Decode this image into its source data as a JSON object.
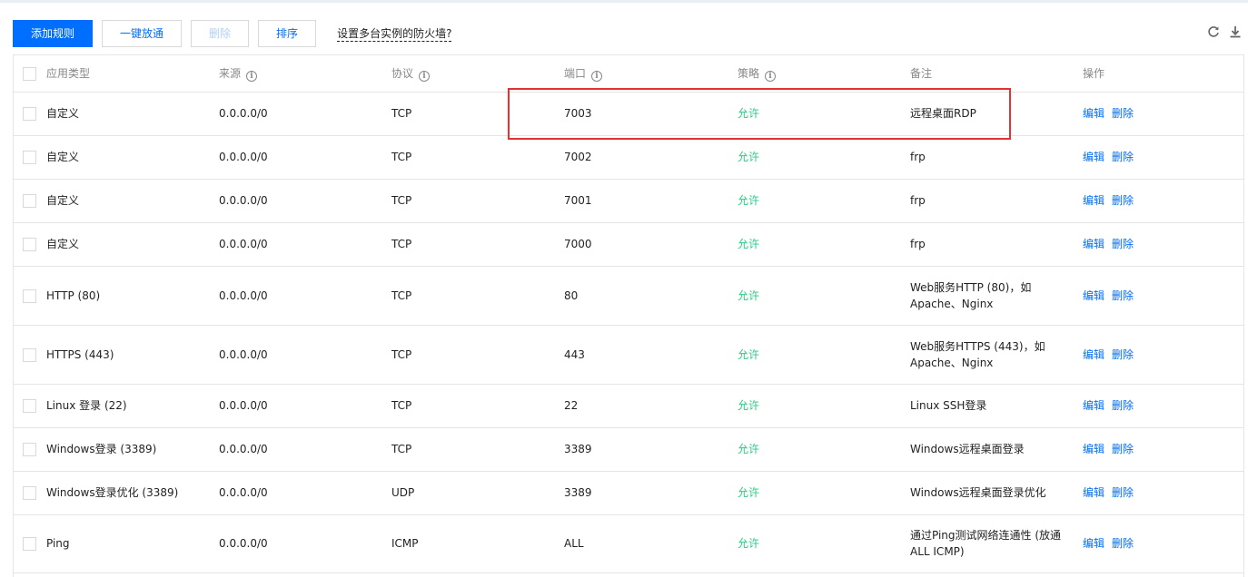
{
  "toolbar": {
    "add_rule": "添加规则",
    "one_click_allow": "一键放通",
    "delete": "删除",
    "sort": "排序",
    "multi_instance_link": "设置多台实例的防火墙?"
  },
  "icons": {
    "refresh": "refresh-icon",
    "download": "download-icon",
    "info": "info-icon"
  },
  "colors": {
    "primary": "#006eff",
    "allow": "#29cc85",
    "highlight": "#e03333"
  },
  "table": {
    "headers": {
      "type": "应用类型",
      "source": "来源",
      "protocol": "协议",
      "port": "端口",
      "policy": "策略",
      "note": "备注",
      "actions": "操作"
    },
    "edit_label": "编辑",
    "delete_label": "删除",
    "rows": [
      {
        "type": "自定义",
        "source": "0.0.0.0/0",
        "protocol": "TCP",
        "port": "7003",
        "policy": "允许",
        "note_lines": [
          "远程桌面RDP"
        ]
      },
      {
        "type": "自定义",
        "source": "0.0.0.0/0",
        "protocol": "TCP",
        "port": "7002",
        "policy": "允许",
        "note_lines": [
          "frp"
        ]
      },
      {
        "type": "自定义",
        "source": "0.0.0.0/0",
        "protocol": "TCP",
        "port": "7001",
        "policy": "允许",
        "note_lines": [
          "frp"
        ]
      },
      {
        "type": "自定义",
        "source": "0.0.0.0/0",
        "protocol": "TCP",
        "port": "7000",
        "policy": "允许",
        "note_lines": [
          "frp"
        ]
      },
      {
        "type": "HTTP (80)",
        "source": "0.0.0.0/0",
        "protocol": "TCP",
        "port": "80",
        "policy": "允许",
        "note_lines": [
          "Web服务HTTP (80)，如",
          "Apache、Nginx"
        ]
      },
      {
        "type": "HTTPS (443)",
        "source": "0.0.0.0/0",
        "protocol": "TCP",
        "port": "443",
        "policy": "允许",
        "note_lines": [
          "Web服务HTTPS (443)，如",
          "Apache、Nginx"
        ]
      },
      {
        "type": "Linux 登录 (22)",
        "source": "0.0.0.0/0",
        "protocol": "TCP",
        "port": "22",
        "policy": "允许",
        "note_lines": [
          "Linux SSH登录"
        ]
      },
      {
        "type": "Windows登录 (3389)",
        "source": "0.0.0.0/0",
        "protocol": "TCP",
        "port": "3389",
        "policy": "允许",
        "note_lines": [
          "Windows远程桌面登录"
        ]
      },
      {
        "type": "Windows登录优化 (3389)",
        "source": "0.0.0.0/0",
        "protocol": "UDP",
        "port": "3389",
        "policy": "允许",
        "note_lines": [
          "Windows远程桌面登录优化"
        ]
      },
      {
        "type": "Ping",
        "source": "0.0.0.0/0",
        "protocol": "ICMP",
        "port": "ALL",
        "policy": "允许",
        "note_lines": [
          "通过Ping测试网络连通性 (放通",
          "ALL ICMP)"
        ]
      }
    ]
  }
}
